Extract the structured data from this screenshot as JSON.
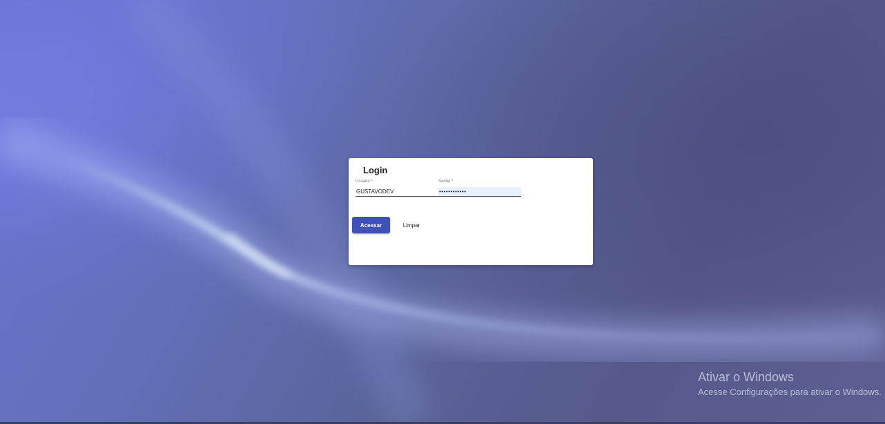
{
  "login": {
    "title": "Login",
    "username_label": "Usuário *",
    "username_value": "GUSTAVODEV",
    "password_label": "Senha *",
    "password_value": "••••••••••••",
    "submit_label": "Acessar",
    "clear_label": "Limpar"
  },
  "watermark": {
    "title": "Ativar o Windows",
    "subtitle": "Acesse Configurações para ativar o Windows."
  },
  "colors": {
    "primary": "#3f51b5",
    "autofill": "#e8f0fe",
    "background": "#545a8c"
  }
}
